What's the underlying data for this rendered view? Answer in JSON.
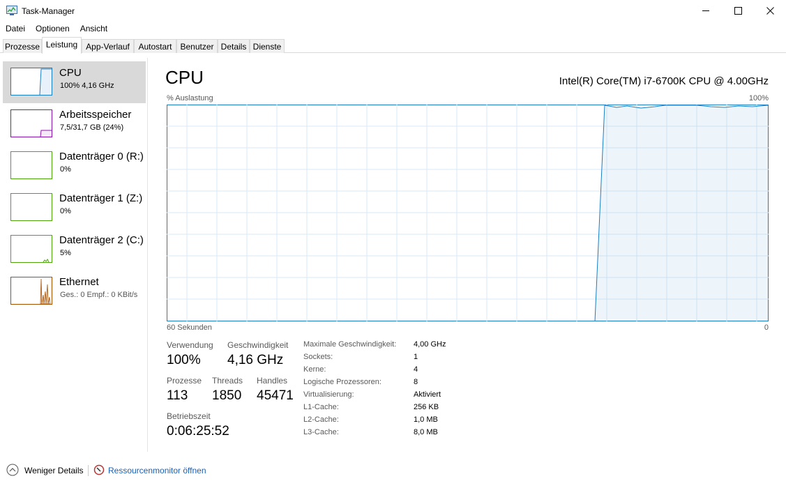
{
  "window": {
    "title": "Task-Manager"
  },
  "menu": [
    "Datei",
    "Optionen",
    "Ansicht"
  ],
  "tabs": [
    "Prozesse",
    "Leistung",
    "App-Verlauf",
    "Autostart",
    "Benutzer",
    "Details",
    "Dienste"
  ],
  "active_tab": "Leistung",
  "sidebar": [
    {
      "title": "CPU",
      "subtitle": "100% 4,16 GHz",
      "color": "#1a7dc4",
      "selected": true
    },
    {
      "title": "Arbeitsspeicher",
      "subtitle": "7,5/31,7 GB (24%)",
      "color": "#8b12ae",
      "selected": false
    },
    {
      "title": "Datenträger 0 (R:)",
      "subtitle": "0%",
      "color": "#4da60c",
      "selected": false
    },
    {
      "title": "Datenträger 1 (Z:)",
      "subtitle": "0%",
      "color": "#4da60c",
      "selected": false
    },
    {
      "title": "Datenträger 2 (C:)",
      "subtitle": "5%",
      "color": "#4da60c",
      "selected": false
    },
    {
      "title": "Ethernet",
      "subtitle": "Ges.: 0 Empf.: 0 KBit/s",
      "color": "#a74f01",
      "selected": false
    }
  ],
  "main": {
    "title": "CPU",
    "cpu_name": "Intel(R) Core(TM) i7-6700K CPU @ 4.00GHz",
    "graph": {
      "y_label": "% Auslastung",
      "y_max_label": "100%",
      "x_label": "60 Sekunden",
      "x_min_label": "0"
    },
    "stats": {
      "usage_label": "Verwendung",
      "usage": "100%",
      "speed_label": "Geschwindigkeit",
      "speed": "4,16 GHz",
      "processes_label": "Prozesse",
      "processes": "113",
      "threads_label": "Threads",
      "threads": "1850",
      "handles_label": "Handles",
      "handles": "45471",
      "uptime_label": "Betriebszeit",
      "uptime": "0:06:25:52"
    },
    "specs": [
      {
        "label": "Maximale Geschwindigkeit:",
        "value": "4,00 GHz"
      },
      {
        "label": "Sockets:",
        "value": "1"
      },
      {
        "label": "Kerne:",
        "value": "4"
      },
      {
        "label": "Logische Prozessoren:",
        "value": "8"
      },
      {
        "label": "Virtualisierung:",
        "value": "Aktiviert"
      },
      {
        "label": "L1-Cache:",
        "value": "256 KB"
      },
      {
        "label": "L2-Cache:",
        "value": "1,0 MB"
      },
      {
        "label": "L3-Cache:",
        "value": "8,0 MB"
      }
    ]
  },
  "footer": {
    "less_details": "Weniger Details",
    "resource_monitor": "Ressourcenmonitor öffnen"
  },
  "icons": {
    "app": "task-manager-icon",
    "minimize": "minimize-icon",
    "maximize": "maximize-icon",
    "close": "close-icon",
    "less_details": "chevron-up-circle-icon",
    "resource_monitor": "resource-monitor-icon"
  },
  "colors": {
    "cpu": "#1a7dc4",
    "memory": "#8b12ae",
    "disk": "#4da60c",
    "ethernet": "#a74f01",
    "link": "#1a5fb4"
  }
}
